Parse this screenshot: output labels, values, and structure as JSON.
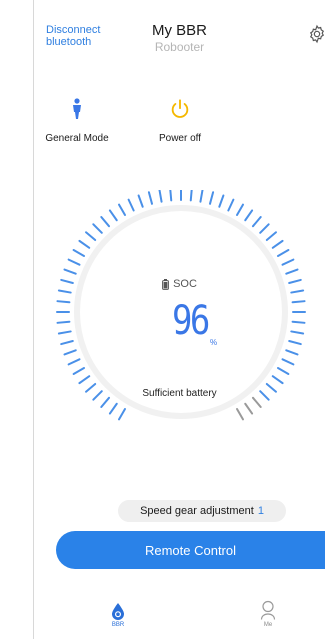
{
  "header": {
    "disconnect_label": "Disconnect bluetooth",
    "title": "My BBR",
    "subtitle": "Robooter"
  },
  "modes": [
    {
      "label": "General Mode",
      "icon": "person-icon"
    },
    {
      "label": "Power off",
      "icon": "power-icon"
    }
  ],
  "battery": {
    "soc_label": "SOC",
    "soc_value": "96",
    "soc_unit": "%",
    "soc_level": 0.96,
    "status": "Sufficient battery"
  },
  "speed": {
    "label": "Speed gear adjustment",
    "value": "1"
  },
  "remote_control_label": "Remote Control",
  "tabs": [
    {
      "label": "BBR",
      "icon": "drop-icon",
      "active": true
    },
    {
      "label": "Me",
      "icon": "person-outline-icon",
      "active": false
    }
  ],
  "colors": {
    "accent": "#2a82e8",
    "tick_active": "#4a90e8",
    "tick_inactive": "#9a9a9a",
    "power": "#f5b800"
  }
}
